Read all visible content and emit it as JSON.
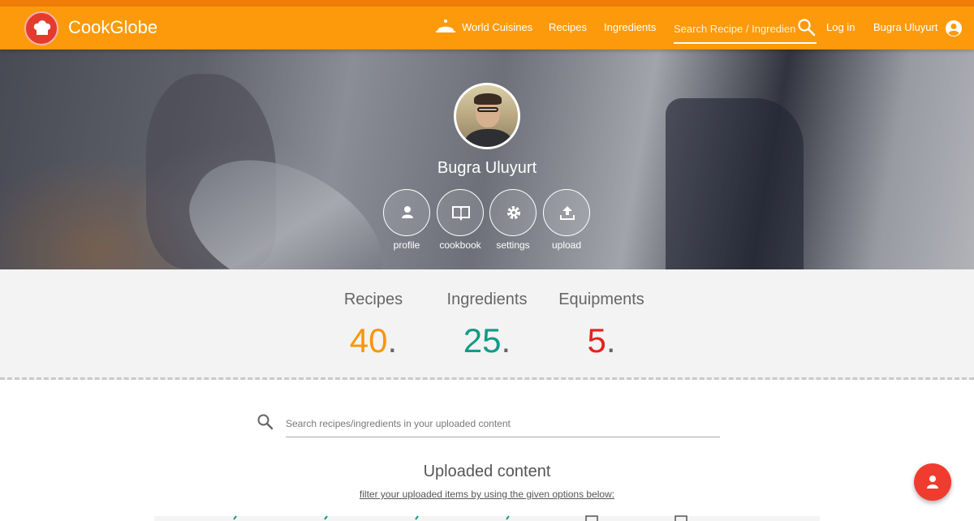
{
  "header": {
    "brand": "CookGlobe",
    "nav": {
      "world_cuisines": "World Cuisines",
      "recipes": "Recipes",
      "ingredients": "Ingredients",
      "login": "Log in",
      "user_name": "Bugra Uluyurt"
    },
    "search_placeholder": "Search Recipe / Ingredient",
    "icons": [
      "chef-hat-icon",
      "cloche-icon",
      "search-icon",
      "account-circle-icon"
    ]
  },
  "profile": {
    "name": "Bugra Uluyurt",
    "actions": [
      {
        "label": "profile",
        "icon": "person-icon"
      },
      {
        "label": "cookbook",
        "icon": "book-icon"
      },
      {
        "label": "settings",
        "icon": "gear-icon"
      },
      {
        "label": "upload",
        "icon": "upload-icon"
      }
    ]
  },
  "stats": {
    "recipes": {
      "label": "Recipes",
      "value": "40",
      "suffix": ".",
      "color": "#f8960c"
    },
    "ingredients": {
      "label": "Ingredients",
      "value": "25",
      "suffix": ".",
      "color": "#139a87"
    },
    "equipments": {
      "label": "Equipments",
      "value": "5",
      "suffix": ".",
      "color": "#e1251b"
    }
  },
  "content": {
    "search_placeholder": "Search recipes/ingredients in your uploaded content",
    "title": "Uploaded content",
    "subtitle": "filter your uploaded items by using the given options below:"
  },
  "colors": {
    "navbar": "#fd9a0c",
    "accent_red": "#ef3c2f"
  }
}
